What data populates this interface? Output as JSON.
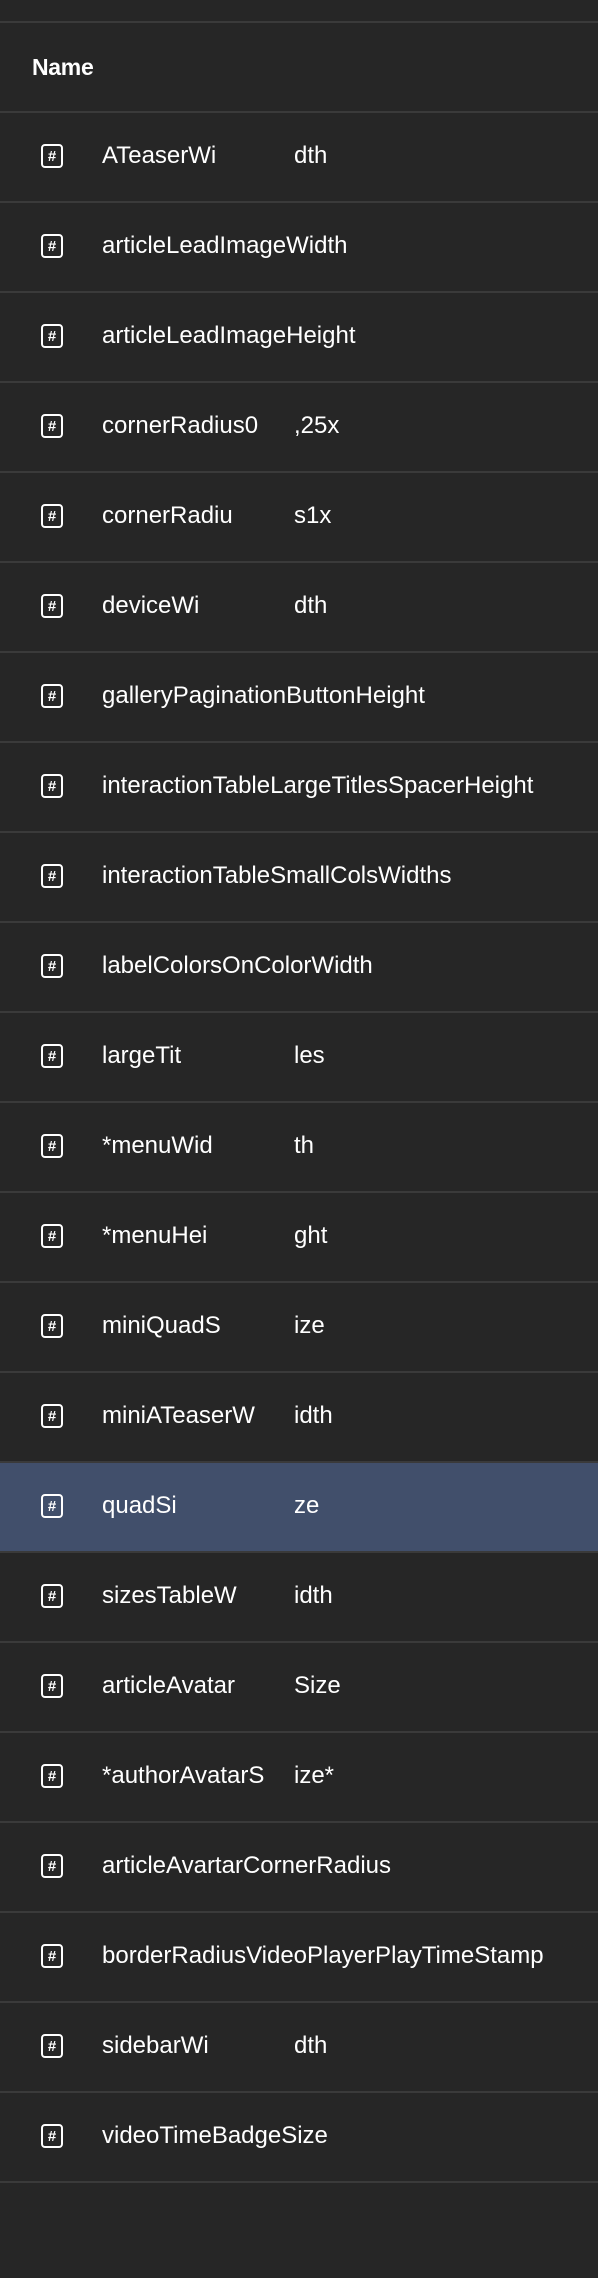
{
  "header": {
    "name_label": "Name"
  },
  "selected_index": 15,
  "rows": [
    {
      "icon": "hash-icon",
      "part1": "ATeaserWi",
      "part2": "dth"
    },
    {
      "icon": "hash-icon",
      "part1": "articleLeadImageWidth",
      "part2": ""
    },
    {
      "icon": "hash-icon",
      "part1": "articleLeadImageHeight",
      "part2": ""
    },
    {
      "icon": "hash-icon",
      "part1": "cornerRadius0",
      "part2": ",25x"
    },
    {
      "icon": "hash-icon",
      "part1": "cornerRadiu",
      "part2": "s1x"
    },
    {
      "icon": "hash-icon",
      "part1": "deviceWi",
      "part2": "dth"
    },
    {
      "icon": "hash-icon",
      "part1": "galleryPaginationButtonHeight",
      "part2": ""
    },
    {
      "icon": "hash-icon",
      "part1": "interactionTableLargeTitlesSpacerHeight",
      "part2": ""
    },
    {
      "icon": "hash-icon",
      "part1": "interactionTableSmallColsWidths",
      "part2": ""
    },
    {
      "icon": "hash-icon",
      "part1": "labelColorsOnColorWidth",
      "part2": ""
    },
    {
      "icon": "hash-icon",
      "part1": "largeTit",
      "part2": "les"
    },
    {
      "icon": "hash-icon",
      "part1": "*menuWid",
      "part2": "th"
    },
    {
      "icon": "hash-icon",
      "part1": "*menuHei",
      "part2": "ght"
    },
    {
      "icon": "hash-icon",
      "part1": "miniQuadS",
      "part2": "ize"
    },
    {
      "icon": "hash-icon",
      "part1": "miniATeaserW",
      "part2": "idth"
    },
    {
      "icon": "hash-icon",
      "part1": "quadSi",
      "part2": "ze"
    },
    {
      "icon": "hash-icon",
      "part1": "sizesTableW",
      "part2": "idth"
    },
    {
      "icon": "hash-icon",
      "part1": "articleAvatar",
      "part2": "Size"
    },
    {
      "icon": "hash-icon",
      "part1": "*authorAvatarS",
      "part2": "ize*"
    },
    {
      "icon": "hash-icon",
      "part1": "articleAvartarCornerRadius",
      "part2": ""
    },
    {
      "icon": "hash-icon",
      "part1": "borderRadiusVideoPlayerPlayTimeStamp",
      "part2": ""
    },
    {
      "icon": "hash-icon",
      "part1": "sidebarWi",
      "part2": "dth"
    },
    {
      "icon": "hash-icon",
      "part1": "videoTimeBadgeSize",
      "part2": ""
    }
  ],
  "colors": {
    "background": "#262626",
    "divider": "#3a3a3a",
    "selected": "#414f6b",
    "text": "#ffffff"
  }
}
